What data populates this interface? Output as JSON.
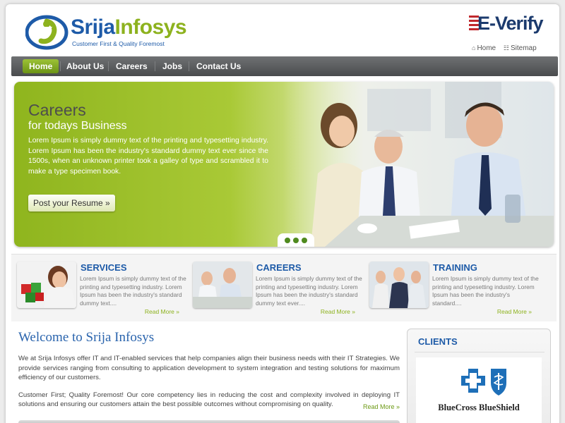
{
  "header": {
    "brand_part1": "Srija",
    "brand_part2": "Infosys",
    "tagline": "Customer First & Quality Foremost",
    "everify_label": "E-Verify",
    "links": [
      {
        "label": "Home",
        "icon": "house-icon"
      },
      {
        "label": "Sitemap",
        "icon": "sitemap-icon"
      }
    ]
  },
  "nav": {
    "items": [
      {
        "label": "Home",
        "active": true
      },
      {
        "label": "About Us",
        "active": false
      },
      {
        "label": "Careers",
        "active": false
      },
      {
        "label": "Jobs",
        "active": false
      },
      {
        "label": "Contact Us",
        "active": false
      }
    ]
  },
  "banner": {
    "title": "Careers",
    "subtitle": "for todays Business",
    "text": "Lorem Ipsum is simply dummy text of the printing and typesetting industry. Lorem Ipsum has been the industry's standard dummy text ever since the 1500s, when an unknown printer took a galley of type and scrambled it to make a type specimen book.",
    "button_label": "Post your Resume »",
    "slide_count": 3
  },
  "features": [
    {
      "title": "SERVICES",
      "text": "Lorem Ipsum is simply dummy text of the printing and typesetting industry. Lorem Ipsum has been the industry's standard dummy text....",
      "more": "Read More »"
    },
    {
      "title": "CAREERS",
      "text": "Lorem Ipsum is simply dummy text of the printing and typesetting industry. Lorem Ipsum has been the industry's standard dummy text ever....",
      "more": "Read More »"
    },
    {
      "title": "TRAINING",
      "text": "Lorem Ipsum is simply dummy text of the printing and typesetting industry. Lorem Ipsum has been the industry's standard....",
      "more": "Read More »"
    }
  ],
  "welcome": {
    "title": "Welcome to Srija Infosys",
    "para1": "We at Srija Infosys offer IT and IT-enabled services that help companies align their business needs with their IT Strategies. We provide services ranging from consulting to application development to system integration and testing solutions for maximum efficiency of our customers.",
    "para2": "Customer First; Quality Foremost! Our core competency lies in reducing the cost and complexity involved in deploying IT solutions and ensuring our customers attain the best possible outcomes without compromising on quality.",
    "more": "Read More »"
  },
  "clients": {
    "title": "CLIENTS",
    "logo_name": "BlueCross BlueShield"
  },
  "colors": {
    "brand_blue": "#1e5ba8",
    "brand_green": "#8db21e",
    "nav_bg": "#5a5c5e",
    "nav_active": "#8cb42a"
  }
}
